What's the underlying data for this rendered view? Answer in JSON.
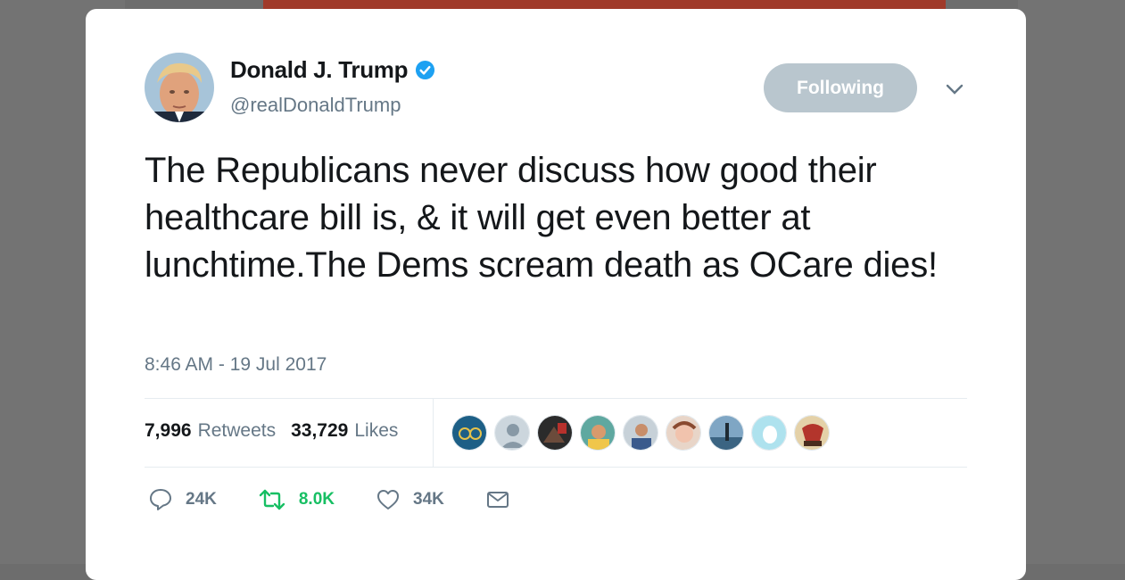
{
  "tweet": {
    "author": {
      "display_name": "Donald J. Trump",
      "handle": "@realDonaldTrump",
      "verified": true
    },
    "follow_button_label": "Following",
    "text": "The Republicans never discuss how good their healthcare bill is, & it will get even better at lunchtime.The Dems scream death as OCare dies!",
    "timestamp": "8:46 AM - 19 Jul 2017",
    "stats": {
      "retweets_count": "7,996",
      "retweets_label": "Retweets",
      "likes_count": "33,729",
      "likes_label": "Likes"
    },
    "actions": {
      "replies": "24K",
      "retweets": "8.0K",
      "likes": "34K"
    }
  },
  "colors": {
    "verified_blue": "#1da1f2",
    "retweet_green": "#17bf63",
    "muted_text": "#657786",
    "following_button": "#b9c6ce"
  },
  "icons": {
    "verified": "verified-badge-icon",
    "more": "chevron-down-icon",
    "reply": "reply-icon",
    "retweet": "retweet-icon",
    "like": "heart-icon",
    "dm": "envelope-icon"
  }
}
